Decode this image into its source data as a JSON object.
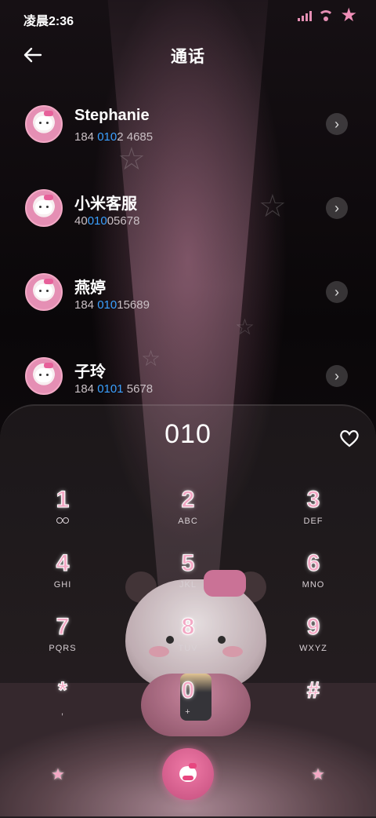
{
  "status_bar": {
    "time": "凌晨2:36",
    "signal_icon": "signal-icon",
    "wifi_icon": "wifi-icon",
    "battery_icon": "star-battery-icon"
  },
  "header": {
    "title": "通话",
    "back_icon": "back-arrow-icon"
  },
  "contacts": [
    {
      "name": "Stephanie",
      "num_pre": "184 ",
      "num_hl": "010",
      "num_post": "2 4685"
    },
    {
      "name": "小米客服",
      "num_pre": "40",
      "num_hl": "010",
      "num_post": "05678"
    },
    {
      "name": "燕婷",
      "num_pre": "184 ",
      "num_hl": "010",
      "num_post": "15689"
    },
    {
      "name": "子玲",
      "num_pre": "184 ",
      "num_hl": "0101",
      "num_post": " 5678"
    }
  ],
  "dialer": {
    "input": "010",
    "keys": [
      {
        "digit": "1",
        "letters": ""
      },
      {
        "digit": "2",
        "letters": "ABC"
      },
      {
        "digit": "3",
        "letters": "DEF"
      },
      {
        "digit": "4",
        "letters": "GHI"
      },
      {
        "digit": "5",
        "letters": "JKL"
      },
      {
        "digit": "6",
        "letters": "MNO"
      },
      {
        "digit": "7",
        "letters": "PQRS"
      },
      {
        "digit": "8",
        "letters": "TUV"
      },
      {
        "digit": "9",
        "letters": "WXYZ"
      },
      {
        "digit": "*",
        "letters": ","
      },
      {
        "digit": "0",
        "letters": "+"
      },
      {
        "digit": "#",
        "letters": ""
      }
    ]
  },
  "colors": {
    "accent_pink": "#f3a9c5",
    "highlight_blue": "#3aa0ff",
    "call_button": "#d9598a"
  }
}
